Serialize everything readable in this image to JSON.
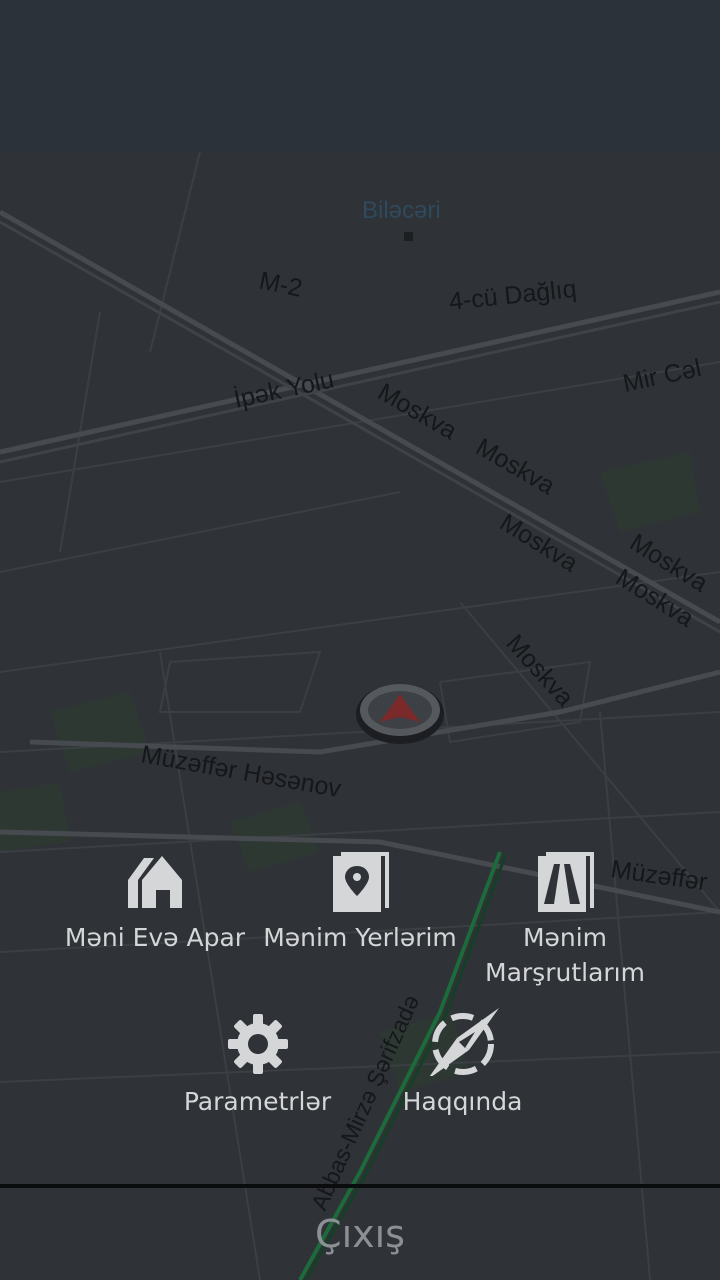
{
  "map": {
    "labels": {
      "district": "Biləcəri",
      "m2": "M-2",
      "dagliq": "4-cü Dağlıq",
      "mircal": "Mir Cəl",
      "ipek": "İpək Yolu",
      "moskva": "Moskva",
      "muzaffar1": "Müzəffər Həsənov",
      "muzaffar2": "Müzəffər",
      "abbas": "Abbas-Mirzə Şərifzadə"
    }
  },
  "menu": {
    "home": "Məni Evə Apar",
    "places": "Mənim Yerlərim",
    "routes_line1": "Mənim",
    "routes_line2": "Marşrutlarım",
    "settings": "Parametrlər",
    "about": "Haqqında"
  },
  "exit_label": "Çıxış",
  "colors": {
    "topbar": "#2c323a",
    "map_bg": "#2f3236",
    "menu_text": "#d4d6d8",
    "exit_text": "#8c9095",
    "nav_arrow": "#7a2a2a"
  }
}
